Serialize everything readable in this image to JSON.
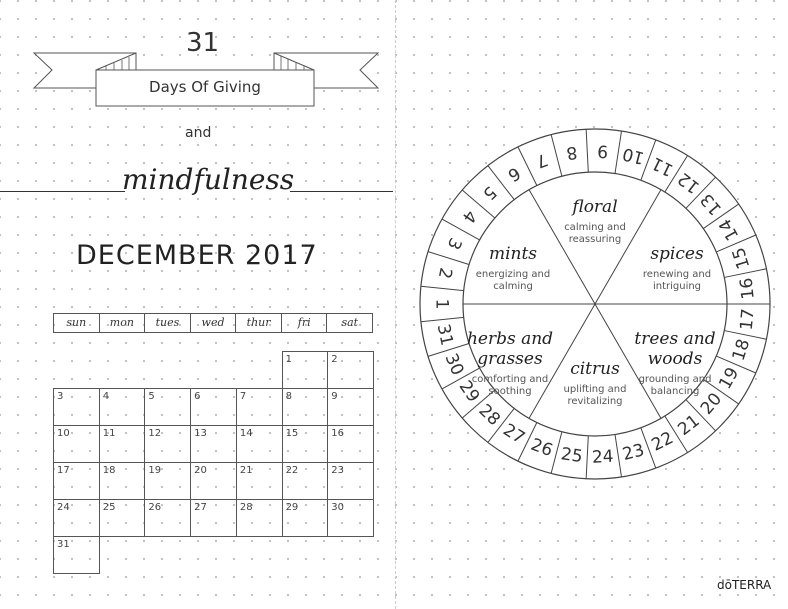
{
  "header": {
    "number": "31",
    "banner_text": "Days Of Giving",
    "conjunction": "and",
    "script_title": "mindfulness"
  },
  "calendar": {
    "title": "DECEMBER 2017",
    "weekdays": [
      "sun",
      "mon",
      "tues",
      "wed",
      "thur",
      "fri",
      "sat"
    ],
    "first_weekday_index": 5,
    "days": [
      "1",
      "2",
      "3",
      "4",
      "5",
      "6",
      "7",
      "8",
      "9",
      "10",
      "11",
      "12",
      "13",
      "14",
      "15",
      "16",
      "17",
      "18",
      "19",
      "20",
      "21",
      "22",
      "23",
      "24",
      "25",
      "26",
      "27",
      "28",
      "29",
      "30",
      "31"
    ]
  },
  "wheel": {
    "day_numbers": [
      "1",
      "2",
      "3",
      "4",
      "5",
      "6",
      "7",
      "8",
      "9",
      "10",
      "11",
      "12",
      "13",
      "14",
      "15",
      "16",
      "17",
      "18",
      "19",
      "20",
      "21",
      "22",
      "23",
      "24",
      "25",
      "26",
      "27",
      "28",
      "29",
      "30",
      "31"
    ],
    "segments": [
      {
        "name": "floral",
        "desc1": "calming and",
        "desc2": "reassuring"
      },
      {
        "name": "spices",
        "desc1": "renewing and",
        "desc2": "intriguing"
      },
      {
        "name": "trees and woods",
        "desc1": "grounding and",
        "desc2": "balancing"
      },
      {
        "name": "citrus",
        "desc1": "uplifting and",
        "desc2": "revitalizing"
      },
      {
        "name": "herbs and grasses",
        "desc1": "comforting and",
        "desc2": "soothing"
      },
      {
        "name": "mints",
        "desc1": "energizing and",
        "desc2": "calming"
      }
    ]
  },
  "brand": "dōTERRA"
}
